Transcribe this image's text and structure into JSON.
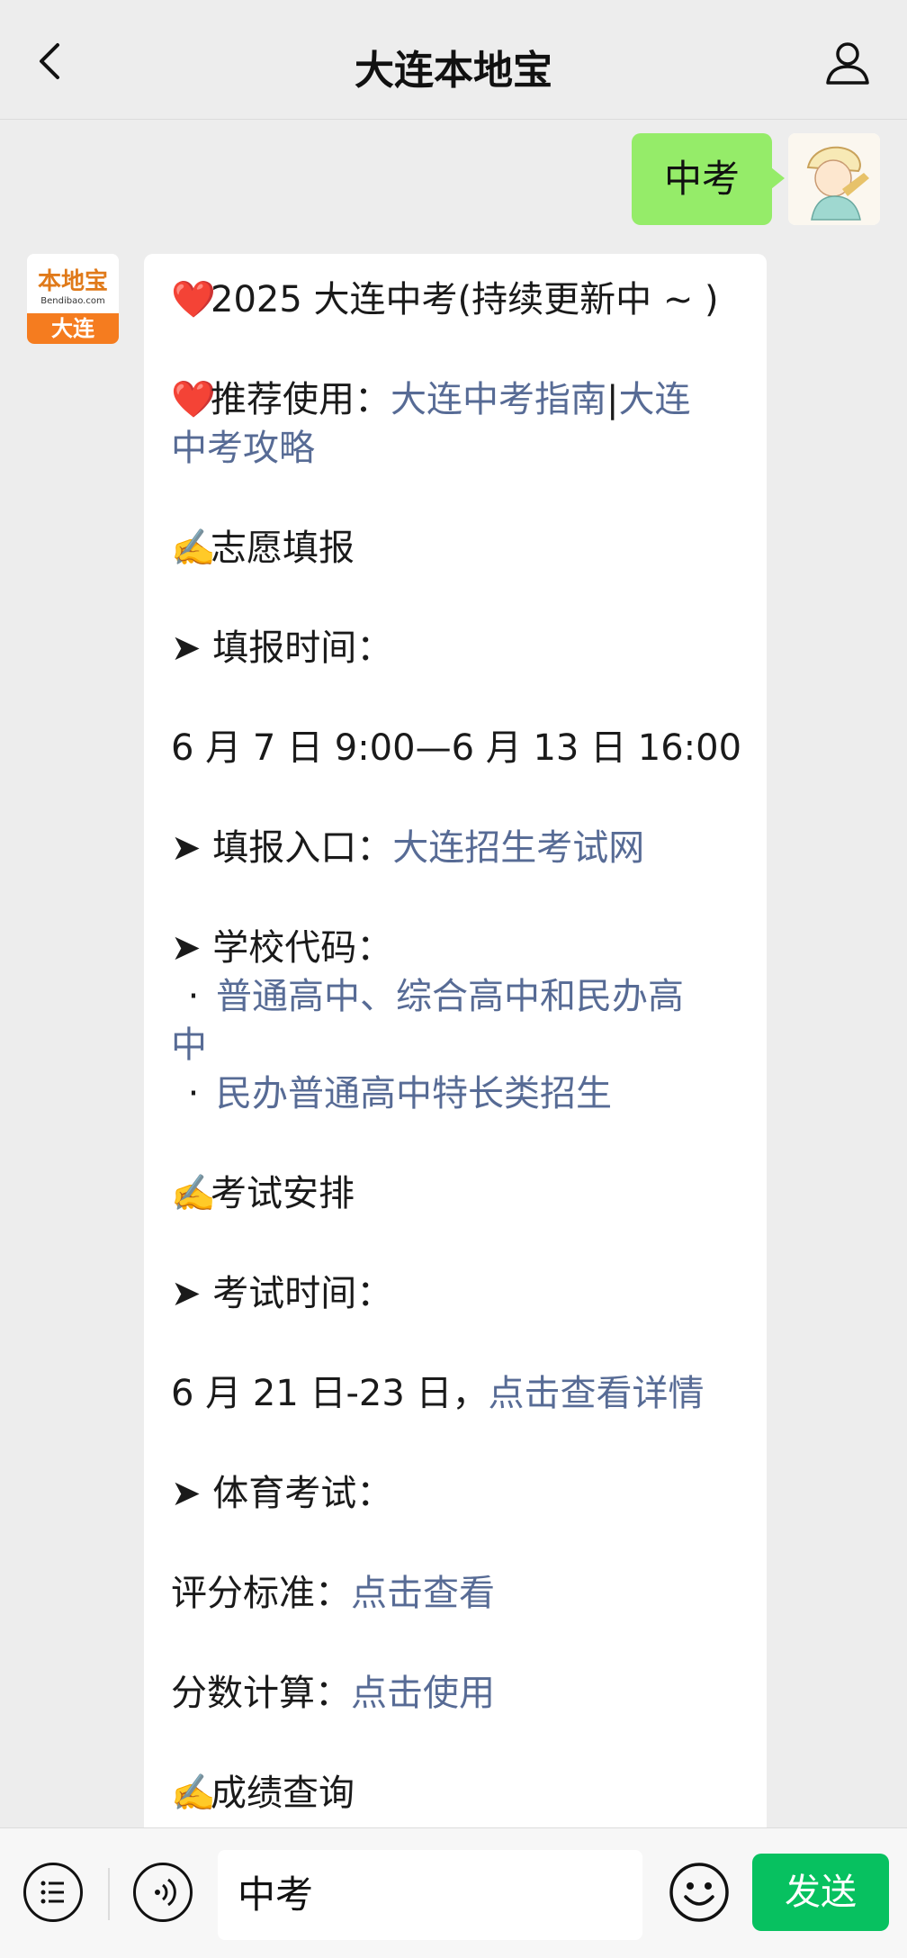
{
  "header": {
    "title": "大连本地宝"
  },
  "user_message": "中考",
  "bot_avatar": {
    "logo_text": "本地宝",
    "logo_sub": "Bendibao.com",
    "city": "大连"
  },
  "bot_message": {
    "heading": "2025 大连中考(持续更新中 ~ )",
    "recommend_label": "推荐使用：",
    "recommend_link1": "大连中考指南",
    "recommend_sep": "|",
    "recommend_link2a": "大连",
    "recommend_link2b": "中考攻略",
    "section1": "志愿填报",
    "fill_time_label": "➤ 填报时间：",
    "fill_time_value": "6 月 7 日 9:00—6 月 13 日 16:00",
    "fill_entry_label": "➤ 填报入口：",
    "fill_entry_link": "大连招生考试网",
    "school_code_label": "➤ 学校代码：",
    "school_code_item1a": "普通高中、综合高中和民办高",
    "school_code_item1b": "中",
    "school_code_item2": "民办普通高中特长类招生",
    "section2": "考试安排",
    "exam_time_label": "➤ 考试时间：",
    "exam_time_value": "6 月 21 日-23 日，",
    "exam_time_link": "点击查看详情",
    "pe_label": "➤ 体育考试：",
    "score_std_label": "评分标准：",
    "score_std_link": "点击查看",
    "score_calc_label": "分数计算：",
    "score_calc_link": "点击使用",
    "section3": "成绩查询"
  },
  "input": {
    "value": "中考"
  },
  "send_label": "发送",
  "icons": [
    "back-icon",
    "profile-icon",
    "heart-icon",
    "writing-hand-icon",
    "menu-icon",
    "voice-icon",
    "emoji-icon"
  ],
  "colors": {
    "accent_green": "#07c160",
    "user_bubble": "#95ec69",
    "link": "#576b95",
    "background": "#ededed"
  }
}
